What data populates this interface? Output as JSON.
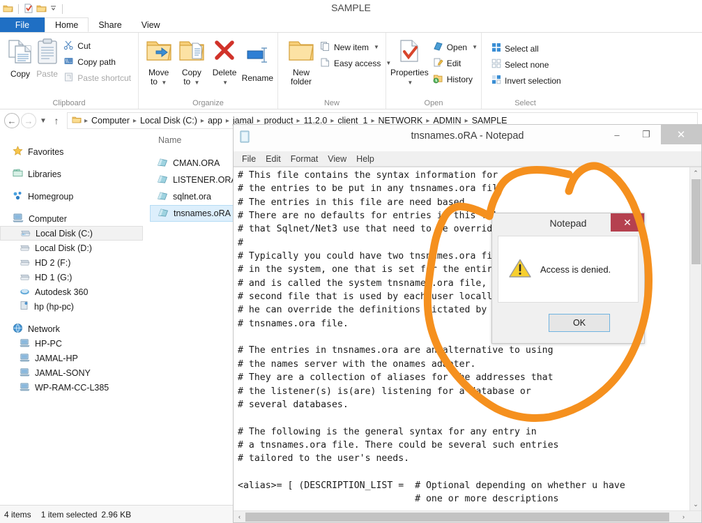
{
  "window": {
    "title": "SAMPLE",
    "quick_access": [
      "folder-icon",
      "properties-icon",
      "new-folder-icon",
      "customize-qat-caret"
    ]
  },
  "ribbon": {
    "tabs": [
      {
        "label": "File",
        "kind": "file"
      },
      {
        "label": "Home",
        "kind": "active"
      },
      {
        "label": "Share",
        "kind": "plain"
      },
      {
        "label": "View",
        "kind": "plain"
      }
    ],
    "groups": [
      {
        "name": "Clipboard",
        "big": [
          {
            "label": "Copy",
            "icon": "copy-icon",
            "enabled": true
          },
          {
            "label": "Paste",
            "icon": "paste-icon",
            "enabled": false
          }
        ],
        "small": [
          {
            "label": "Cut",
            "icon": "scissors-icon",
            "enabled": true,
            "caret": false
          },
          {
            "label": "Copy path",
            "icon": "copy-path-icon",
            "enabled": true,
            "caret": false
          },
          {
            "label": "Paste shortcut",
            "icon": "paste-shortcut-icon",
            "enabled": false,
            "caret": false
          }
        ]
      },
      {
        "name": "Organize",
        "big": [
          {
            "label": "Move\nto",
            "icon": "move-to-icon",
            "enabled": true,
            "caret": true
          },
          {
            "label": "Copy\nto",
            "icon": "copy-to-icon",
            "enabled": true,
            "caret": true
          },
          {
            "label": "Delete",
            "icon": "delete-icon",
            "enabled": true,
            "caret": true
          },
          {
            "label": "Rename",
            "icon": "rename-icon",
            "enabled": true,
            "caret": false
          }
        ],
        "small": []
      },
      {
        "name": "New",
        "big": [
          {
            "label": "New\nfolder",
            "icon": "new-folder-icon",
            "enabled": true
          }
        ],
        "small": [
          {
            "label": "New item",
            "icon": "new-item-icon",
            "enabled": true,
            "caret": true
          },
          {
            "label": "Easy access",
            "icon": "easy-access-icon",
            "enabled": true,
            "caret": true
          }
        ]
      },
      {
        "name": "Open",
        "big": [
          {
            "label": "Properties",
            "icon": "properties-icon",
            "enabled": true,
            "caret": true
          }
        ],
        "small": [
          {
            "label": "Open",
            "icon": "open-icon",
            "enabled": true,
            "caret": true
          },
          {
            "label": "Edit",
            "icon": "edit-icon",
            "enabled": true,
            "caret": false
          },
          {
            "label": "History",
            "icon": "history-icon",
            "enabled": true,
            "caret": false
          }
        ]
      },
      {
        "name": "Select",
        "big": [],
        "small": [
          {
            "label": "Select all",
            "icon": "select-all-icon",
            "enabled": true,
            "caret": false
          },
          {
            "label": "Select none",
            "icon": "select-none-icon",
            "enabled": true,
            "caret": false
          },
          {
            "label": "Invert selection",
            "icon": "invert-selection-icon",
            "enabled": true,
            "caret": false
          }
        ]
      }
    ]
  },
  "address": {
    "back_icon": "back-arrow-icon",
    "forward_icon": "forward-arrow-icon",
    "recent_icon": "recent-locations-caret",
    "up_icon": "up-arrow-icon",
    "breadcrumbs": [
      "Computer",
      "Local Disk (C:)",
      "app",
      "jamal",
      "product",
      "11.2.0",
      "client_1",
      "NETWORK",
      "ADMIN",
      "SAMPLE"
    ]
  },
  "navpane": {
    "items": [
      {
        "label": "Favorites",
        "icon": "star-icon",
        "level": 0,
        "selected": false,
        "spaced": true
      },
      {
        "label": "Libraries",
        "icon": "libraries-icon",
        "level": 0,
        "selected": false,
        "spaced": true
      },
      {
        "label": "Homegroup",
        "icon": "homegroup-icon",
        "level": 0,
        "selected": false,
        "spaced": true
      },
      {
        "label": "Computer",
        "icon": "computer-icon",
        "level": 0,
        "selected": false,
        "spaced": true
      },
      {
        "label": "Local Disk (C:)",
        "icon": "drive-icon",
        "level": 1,
        "selected": true,
        "spaced": false
      },
      {
        "label": "Local Disk (D:)",
        "icon": "drive-icon",
        "level": 1,
        "selected": false,
        "spaced": false
      },
      {
        "label": "HD 2 (F:)",
        "icon": "drive-icon",
        "level": 1,
        "selected": false,
        "spaced": false
      },
      {
        "label": "HD 1 (G:)",
        "icon": "drive-icon",
        "level": 1,
        "selected": false,
        "spaced": false
      },
      {
        "label": "Autodesk 360",
        "icon": "cloud-icon",
        "level": 1,
        "selected": false,
        "spaced": false
      },
      {
        "label": "hp (hp-pc)",
        "icon": "user-folder-icon",
        "level": 1,
        "selected": false,
        "spaced": false
      },
      {
        "label": "Network",
        "icon": "network-icon",
        "level": 0,
        "selected": false,
        "spaced": true
      },
      {
        "label": "HP-PC",
        "icon": "pc-icon",
        "level": 1,
        "selected": false,
        "spaced": false
      },
      {
        "label": "JAMAL-HP",
        "icon": "pc-icon",
        "level": 1,
        "selected": false,
        "spaced": false
      },
      {
        "label": "JAMAL-SONY",
        "icon": "pc-icon",
        "level": 1,
        "selected": false,
        "spaced": false
      },
      {
        "label": "WP-RAM-CC-L385",
        "icon": "pc-icon",
        "level": 1,
        "selected": false,
        "spaced": false
      }
    ]
  },
  "filelist": {
    "column_header": "Name",
    "files": [
      {
        "name": "CMAN.ORA",
        "icon": "ora-file-icon",
        "selected": false
      },
      {
        "name": "LISTENER.ORA",
        "icon": "ora-file-icon",
        "selected": false
      },
      {
        "name": "sqlnet.ora",
        "icon": "ora-file-icon",
        "selected": false
      },
      {
        "name": "tnsnames.oRA",
        "icon": "ora-file-icon",
        "selected": true
      }
    ]
  },
  "statusbar": {
    "item_count": "4 items",
    "selection": "1 item selected",
    "size": "2.96 KB"
  },
  "notepad": {
    "title": "tnsnames.oRA - Notepad",
    "icon": "notepad-icon",
    "menu": [
      "File",
      "Edit",
      "Format",
      "View",
      "Help"
    ],
    "window_buttons": {
      "minimize": "–",
      "maximize": "❐",
      "close": "✕"
    },
    "content": "# This file contains the syntax information for\n# the entries to be put in any tnsnames.ora file\n# The entries in this file are need based.\n# There are no defaults for entries in this file\n# that Sqlnet/Net3 use that need to be overridden\n#\n# Typically you could have two tnsnames.ora files\n# in the system, one that is set for the entire system\n# and is called the system tnsnames.ora file, and a\n# second file that is used by each user locally so that\n# he can override the definitions dictated by the system\n# tnsnames.ora file.\n\n# The entries in tnsnames.ora are an alternative to using\n# the names server with the onames adapter.\n# They are a collection of aliases for the addresses that\n# the listener(s) is(are) listening for a database or\n# several databases.\n\n# The following is the general syntax for any entry in\n# a tnsnames.ora file. There could be several such entries\n# tailored to the user's needs.\n\n<alias>= [ (DESCRIPTION_LIST =  # Optional depending on whether u have\n                                # one or more descriptions"
  },
  "dialog": {
    "title": "Notepad",
    "message": "Access is denied.",
    "ok_label": "OK",
    "close_glyph": "✕",
    "warning_icon": "warning-triangle-icon",
    "close_color": "#b5414f"
  },
  "annotation": {
    "color": "#f5901e",
    "shape": "hand-drawn-circle",
    "stroke_width": 11
  }
}
